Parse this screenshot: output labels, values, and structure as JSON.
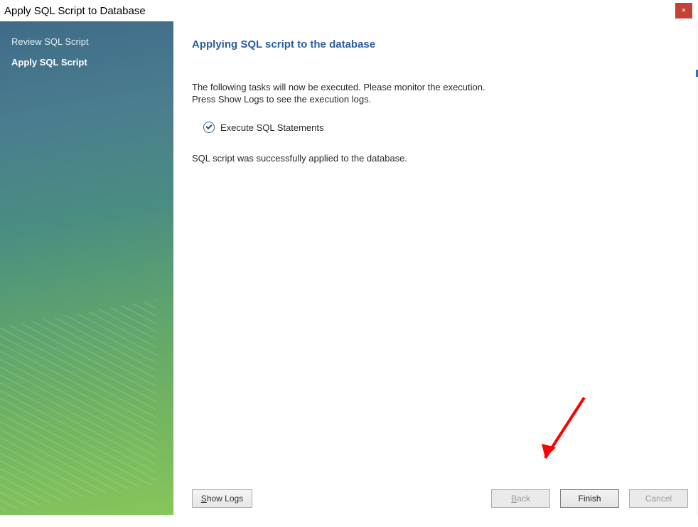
{
  "title_bar": {
    "title": "Apply SQL Script to Database",
    "close_icon": "×"
  },
  "sidebar": {
    "items": [
      {
        "label": "Review SQL Script",
        "active": false
      },
      {
        "label": "Apply SQL Script",
        "active": true
      }
    ]
  },
  "main": {
    "heading": "Applying SQL script to the database",
    "intro_line1": "The following tasks will now be executed. Please monitor the execution.",
    "intro_line2": "Press Show Logs to see the execution logs.",
    "task_label": "Execute SQL Statements",
    "result_text": "SQL script was successfully applied to the database."
  },
  "buttons": {
    "show_logs": {
      "prefix": "S",
      "rest": "how Logs"
    },
    "back": {
      "prefix": "B",
      "rest": "ack"
    },
    "finish": {
      "label": "Finish"
    },
    "cancel": {
      "label": "Cancel"
    }
  }
}
